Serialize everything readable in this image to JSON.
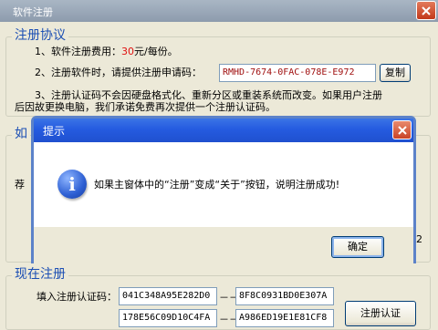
{
  "window": {
    "title": "软件注册"
  },
  "agreement": {
    "title": "注册协议",
    "line1_prefix": "1、软件注册费用：",
    "line1_price": "30",
    "line1_suffix": "元/每份。",
    "line2": "2、注册软件时，请提供注册申请码：",
    "request_code": "RMHD-7674-0FAC-078E-E972",
    "copy_label": "复制",
    "line3a": "3、注册认证码不会因硬盘格式化、重新分区或重装系统而改变。如果用户注册",
    "line3b": "后因故更换电脑，我们承诺免费再次提供一个注册认证码。"
  },
  "partial_group": {
    "title": "如",
    "left_char": "荐",
    "right_char": "2"
  },
  "register": {
    "title": "现在注册",
    "input_label": "填入注册认证码：",
    "code1": "041C348A95E282D0",
    "code2": "8F8C0931BD0E307A",
    "code3": "178E56C09D10C4FA",
    "code4": "A986ED19E1E81CF8",
    "dash": "－－",
    "button_label": "注册认证"
  },
  "dialog": {
    "title": "提示",
    "message": "如果主窗体中的“注册”变成“关于”按钮，说明注册成功!",
    "ok_label": "确定"
  }
}
